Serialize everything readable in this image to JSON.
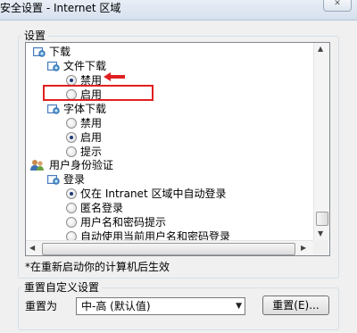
{
  "window": {
    "title": "安全设置 - Internet 区域",
    "close_glyph": "✕"
  },
  "settings_group": {
    "label": "设置"
  },
  "tree": [
    {
      "type": "folder",
      "label": "下载"
    },
    {
      "type": "folder",
      "label": "文件下载"
    },
    {
      "type": "radio",
      "label": "禁用",
      "checked": true
    },
    {
      "type": "radio",
      "label": "启用",
      "checked": false
    },
    {
      "type": "folder",
      "label": "字体下载"
    },
    {
      "type": "radio",
      "label": "禁用",
      "checked": false
    },
    {
      "type": "radio",
      "label": "启用",
      "checked": true
    },
    {
      "type": "radio",
      "label": "提示",
      "checked": false
    },
    {
      "type": "folder",
      "label": "用户身份验证"
    },
    {
      "type": "folder",
      "label": "登录"
    },
    {
      "type": "radio",
      "label": "仅在 Intranet 区域中自动登录",
      "checked": true
    },
    {
      "type": "radio",
      "label": "匿名登录",
      "checked": false
    },
    {
      "type": "radio",
      "label": "用户名和密码提示",
      "checked": false
    },
    {
      "type": "radio",
      "label": "自动使用当前用户名和密码登录",
      "checked": false
    }
  ],
  "note": "*在重新启动你的计算机后生效",
  "reset_group": {
    "label": "重置自定义设置"
  },
  "reset_to": {
    "label": "重置为",
    "value": "中-高 (默认值)"
  },
  "reset_button": {
    "label": "重置(E)..."
  },
  "annotation_color": "#e02020",
  "icons": {
    "folder": "settings-folder-icon",
    "user": "users-icon",
    "close": "close-icon",
    "dropdown": "chevron-down-icon"
  }
}
